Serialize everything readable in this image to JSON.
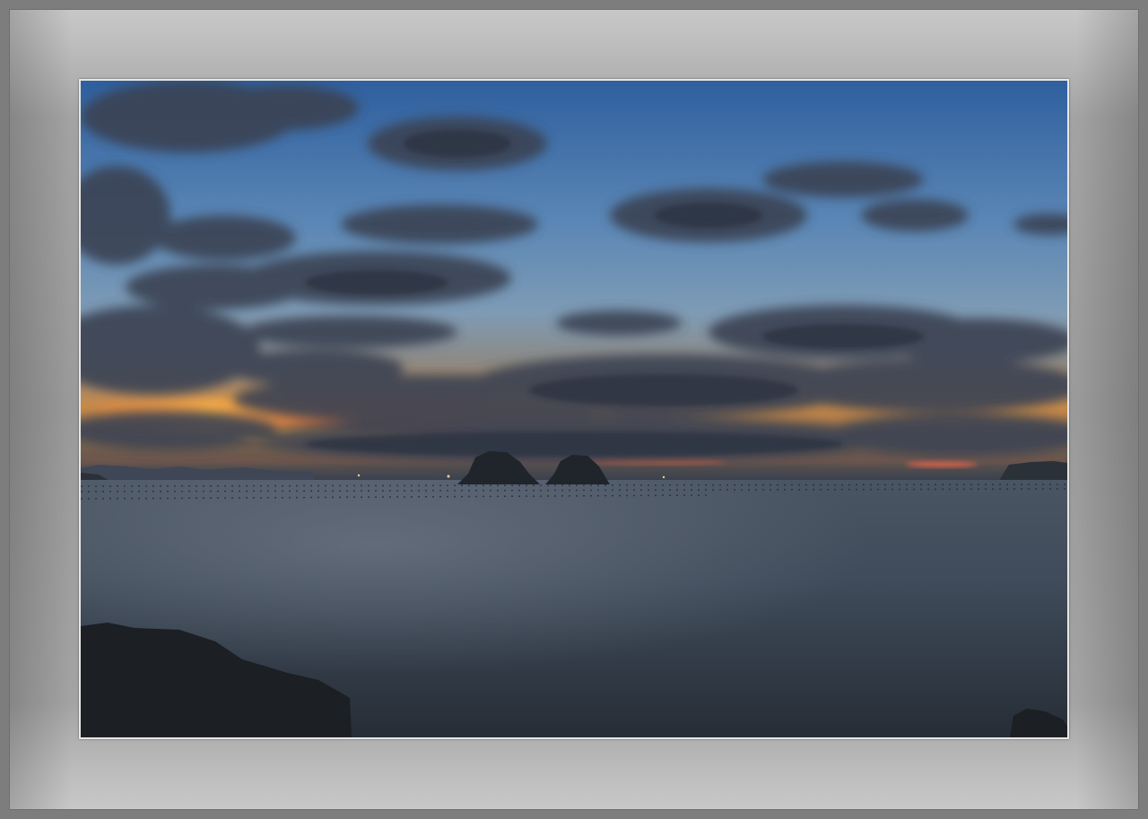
{
  "frame": {
    "mat_color": "#a0a0a0",
    "outer_color": "#7d7d7d",
    "inner_border_color": "#e6e6e6"
  },
  "scene": {
    "sky_top": "#3d6ba8",
    "sky_mid": "#6f93b8",
    "horizon_glow": "#f0a040",
    "sea_color": "#3e4c5c",
    "rock_color": "#1e2226"
  }
}
